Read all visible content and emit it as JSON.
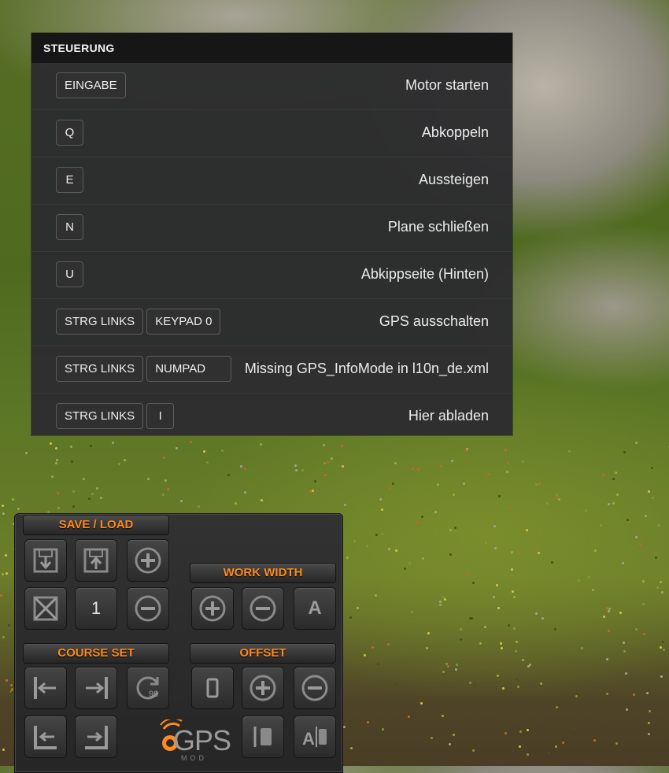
{
  "controls": {
    "title": "STEUERUNG",
    "rows": [
      {
        "keys": [
          "EINGABE"
        ],
        "action": "Motor starten"
      },
      {
        "keys": [
          "Q"
        ],
        "action": "Abkoppeln"
      },
      {
        "keys": [
          "E"
        ],
        "action": "Aussteigen"
      },
      {
        "keys": [
          "N"
        ],
        "action": "Plane schließen"
      },
      {
        "keys": [
          "U"
        ],
        "action": "Abkippseite (Hinten)"
      },
      {
        "keys": [
          "STRG LINKS",
          "KEYPAD 0"
        ],
        "action": "GPS ausschalten"
      },
      {
        "keys": [
          "STRG LINKS",
          "NUMPAD"
        ],
        "action": "Missing GPS_InfoMode in l10n_de.xml"
      },
      {
        "keys": [
          "STRG LINKS",
          "I"
        ],
        "action": "Hier abladen"
      }
    ]
  },
  "gps_hud": {
    "accent_color": "#ff8a1e",
    "save_load_label": "SAVE / LOAD",
    "work_width_label": "WORK WIDTH",
    "course_set_label": "COURSE SET",
    "offset_label": "OFFSET",
    "slot_number": "1",
    "work_width_auto": "A",
    "logo_text": "GPS",
    "logo_sub": "MOD",
    "icons": {
      "save": "save-down-icon",
      "load": "load-up-icon",
      "add_slot": "plus-icon",
      "delete_slot": "delete-slot-icon",
      "remove_slot": "minus-icon",
      "width_plus": "plus-icon",
      "width_minus": "minus-icon",
      "course_left": "shift-left-icon",
      "course_right": "shift-right-icon",
      "rotate90": "rotate-90-icon",
      "corner_left": "corner-left-icon",
      "corner_right": "corner-right-icon",
      "offset_reset": "offset-zero-icon",
      "offset_plus": "plus-icon",
      "offset_minus": "minus-icon",
      "offset_left": "offset-left-icon",
      "offset_auto": "offset-auto-icon"
    }
  }
}
